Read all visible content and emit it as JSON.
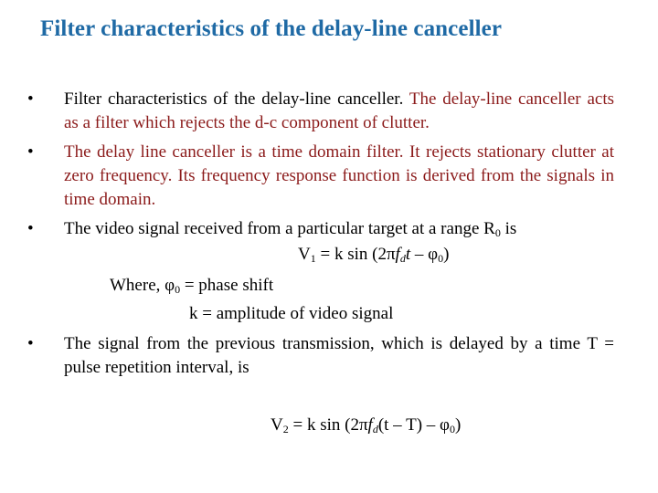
{
  "slide": {
    "title": "Filter characteristics of the delay-line canceller",
    "colors": {
      "title": "#1f6aa5",
      "highlight": "#8b1a1a",
      "text": "#000000"
    },
    "bullet_glyph": "•",
    "bullets": [
      {
        "text_plain": "Filter characteristics of the delay-line canceller.",
        "text_highlight": " The delay-line canceller acts as a filter which rejects the d-c component of clutter."
      },
      {
        "text_highlight": "The delay line canceller is a time domain filter.  It rejects stationary clutter at zero frequency.  Its frequency response function is derived from the signals in time domain."
      },
      {
        "text_plain": "The video signal received from a particular target at a range R",
        "sub": "0",
        "text_after": " is"
      },
      {
        "text_plain": "The signal from the previous transmission, which is delayed by a time T = pulse repetition interval, is"
      }
    ],
    "equation1": {
      "lhs": "V",
      "lhs_sub": "1",
      "part1": " = k sin (2π",
      "f": "f",
      "f_sub": "d",
      "t": "t",
      "part2": " – φ",
      "phi_sub": "0",
      "close": ")"
    },
    "where": {
      "label": "Where,  φ",
      "sub": "0",
      "text": " = phase shift"
    },
    "k_def": "k = amplitude of video signal",
    "equation2": {
      "lhs": "V",
      "lhs_sub": "2",
      "part1": " = k sin (2π",
      "f": "f",
      "f_sub": "d",
      "part2": "(t – T) – φ",
      "phi_sub": "0",
      "close": ")"
    }
  }
}
